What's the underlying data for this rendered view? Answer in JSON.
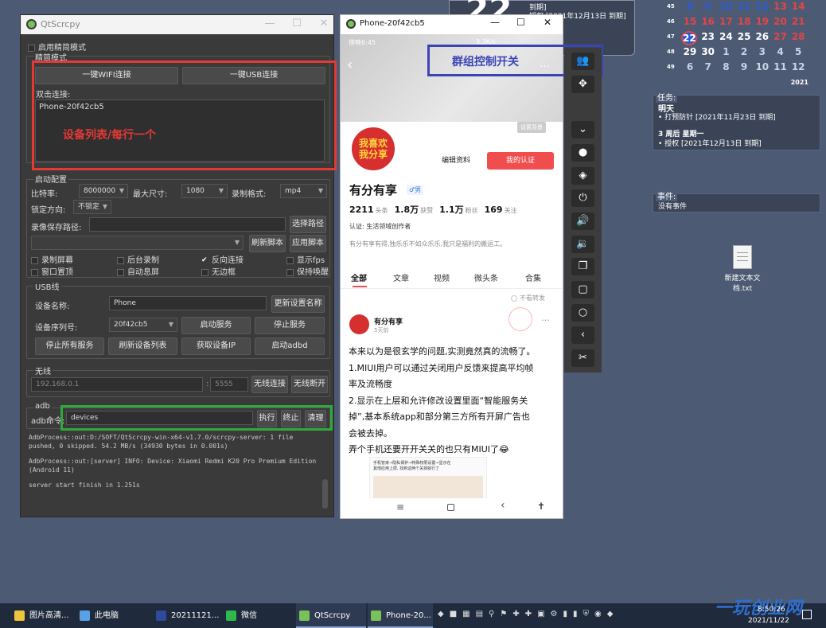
{
  "desktop": {
    "widget_top": {
      "day": "22",
      "line1": "到期]",
      "line2": "授权 [2021年12月13日 到期]"
    },
    "calendar": {
      "weeks": [
        {
          "wk": "45",
          "days": [
            "8",
            "9",
            "10",
            "11",
            "12",
            "13",
            "14"
          ]
        },
        {
          "wk": "46",
          "days": [
            "15",
            "16",
            "17",
            "18",
            "19",
            "20",
            "21"
          ]
        },
        {
          "wk": "47",
          "days": [
            "22",
            "23",
            "24",
            "25",
            "26",
            "27",
            "28"
          ]
        },
        {
          "wk": "48",
          "days": [
            "29",
            "30",
            "1",
            "2",
            "3",
            "4",
            "5"
          ]
        },
        {
          "wk": "49",
          "days": [
            "6",
            "7",
            "8",
            "9",
            "10",
            "11",
            "12"
          ]
        }
      ],
      "year": "2021"
    },
    "tasks_panel": {
      "title": "任务:",
      "heading": "明天",
      "item1": "• 打预防针 [2021年11月23日 到期]",
      "heading2": "3 周后 星期一",
      "item2": "• 授权 [2021年12月13日 到期]"
    },
    "events_panel": {
      "title": "事件:",
      "empty": "没有事件"
    },
    "file_icon": {
      "label1": "新建文本文",
      "label2": "档.txt"
    }
  },
  "qt": {
    "title": "QtScrcpy",
    "simple_mode": "启用精简模式",
    "simple_mode_group": "精简模式",
    "wifi_btn": "一键WIFI连接",
    "usb_btn": "一键USB连接",
    "dblclick_label": "双击连接:",
    "device_item": "Phone-20f42cb5",
    "annotation_devlist": "设备列表/每行一个",
    "start_group": "启动配置",
    "bitrate_label": "比特率:",
    "bitrate_val": "8000000",
    "maxsize_label": "最大尺寸:",
    "maxsize_val": "1080",
    "recfmt_label": "录制格式:",
    "recfmt_val": "mp4",
    "lockdir_label": "锁定方向:",
    "lockdir_val": "不锁定",
    "recpath_label": "录像保存路径:",
    "choose_path_btn": "选择路径",
    "refresh_script_btn": "刷新脚本",
    "apply_script_btn": "应用脚本",
    "opts": [
      {
        "label": "录制屏幕",
        "checked": false
      },
      {
        "label": "后台录制",
        "checked": false
      },
      {
        "label": "反向连接",
        "checked": true
      },
      {
        "label": "显示fps",
        "checked": false
      },
      {
        "label": "窗口置顶",
        "checked": false
      },
      {
        "label": "自动息屏",
        "checked": false
      },
      {
        "label": "无边框",
        "checked": false
      },
      {
        "label": "保持唤醒",
        "checked": false
      }
    ],
    "usb_group": "USB线",
    "devname_label": "设备名称:",
    "devname_val": "Phone",
    "update_name_btn": "更新设置名称",
    "serial_label": "设备序列号:",
    "serial_val": "20f42cb5",
    "start_service_btn": "启动服务",
    "stop_service_btn": "停止服务",
    "stop_all_btn": "停止所有服务",
    "refresh_dev_btn": "刷新设备列表",
    "get_ip_btn": "获取设备IP",
    "start_adbd_btn": "启动adbd",
    "wireless_group": "无线",
    "ip_placeholder": "192.168.0.1",
    "port_placeholder": "5555",
    "wireless_connect_btn": "无线连接",
    "wireless_disconnect_btn": "无线断开",
    "adb_group": "adb",
    "adb_cmd_label": "adb命令:",
    "adb_cmd_val": "devices",
    "exec_btn": "执行",
    "stop_btn": "终止",
    "clear_btn": "清理",
    "log": [
      "AdbProcess::out:D:/SOFT/QtScrcpy-win-x64-v1.7.0/scrcpy-server: 1 file",
      "pushed, 0 skipped. 54.2 MB/s (34930 bytes in 0.001s)",
      "",
      "AdbProcess::out:[server] INFO: Device: Xiaomi Redmi K20 Pro Premium Edition",
      "(Android 11)",
      "",
      "server start finish in 1.251s"
    ]
  },
  "phone": {
    "title": "Phone-20f42cb5",
    "status_time": "傍晚6:45",
    "status_right": "3.3K/s",
    "annotation_group": "群组控制开关",
    "bg_btn": "设置背景",
    "avatar_text1": "我喜欢",
    "avatar_text2": "我分享",
    "edit_btn": "编辑资料",
    "verify_btn": "我的认证",
    "name": "有分有享",
    "gender": "♂男",
    "stats": [
      {
        "num": "2211",
        "unit": "头条"
      },
      {
        "num": "1.8万",
        "unit": "获赞"
      },
      {
        "num": "1.1万",
        "unit": "粉丝"
      },
      {
        "num": "169",
        "unit": "关注"
      }
    ],
    "cert": "认证: 生活领域创作者",
    "bio": "有分有享有得,独乐乐不如众乐乐,我只是福利的搬运工。",
    "tabs": [
      "全部",
      "文章",
      "视频",
      "微头条",
      "合集"
    ],
    "no_repost": "不看转发",
    "post_author": "有分有享",
    "post_time": "5天前",
    "post_lines": [
      "本来以为是很玄学的问题,实测竟然真的流畅了。",
      "1.MIUI用户可以通过关闭用户反馈来提高平均帧",
      "率及流畅度",
      "2.显示在上层和允许修改设置里面“智能服务关",
      "掉”,基本系统app和部分第三方所有开屏广告也",
      "会被去掉。",
      "弄个手机还要开开关关的也只有MIUI了😂"
    ],
    "img_caption1": "手机管家→隐私保护→特殊权限设置→显示在",
    "img_caption2": "其他应用上层, 找到这两个关掉就行了"
  },
  "taskbar": {
    "items": [
      {
        "label": "图片高清..."
      },
      {
        "label": "此电脑"
      },
      {
        "label": "20211121..."
      },
      {
        "label": "微信"
      },
      {
        "label": "QtScrcpy"
      },
      {
        "label": "Phone-20..."
      }
    ],
    "time": "8:50:26",
    "date": "2021/11/22",
    "watermark": "一玩创业网"
  },
  "colors": {
    "accent_red": "#e53935",
    "accent_green": "#2eaa3c",
    "accent_blue": "#3a45b5",
    "verify_red": "#f04e4e"
  }
}
